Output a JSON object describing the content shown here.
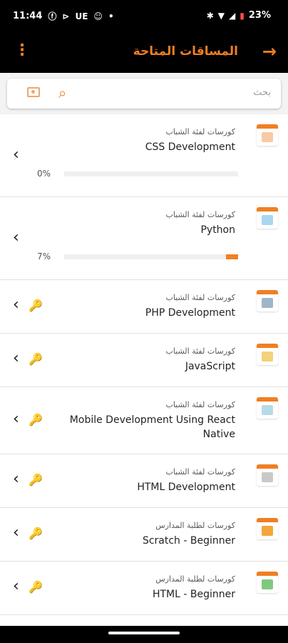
{
  "status": {
    "time": "11:44",
    "carrier_label": "UE",
    "dot": "•",
    "battery": "23%",
    "left_icons": [
      "facebook-icon",
      "playstation-icon",
      "snapchat-icon"
    ],
    "right_icons": [
      "bluetooth-icon",
      "wifi-icon",
      "signal-icon",
      "battery-icon"
    ]
  },
  "app_bar": {
    "title": "المساقات المتاحة",
    "back_glyph": "→",
    "menu_glyph": "⋮"
  },
  "search": {
    "placeholder": "بحث"
  },
  "courses": [
    {
      "category": "كورسات لفئة الشباب",
      "title": "CSS Development",
      "progress_text": "0%",
      "progress": 0,
      "locked": false
    },
    {
      "category": "كورسات لفئة الشباب",
      "title": "Python",
      "progress_text": "7%",
      "progress": 0.07,
      "locked": false
    },
    {
      "category": "كورسات لفئة الشباب",
      "title": "PHP Development",
      "locked": true
    },
    {
      "category": "كورسات لفئة الشباب",
      "title": "JavaScript",
      "locked": true
    },
    {
      "category": "كورسات لفئة الشباب",
      "title_line1": "Mobile Development Using React",
      "title_line2": "Native",
      "locked": true
    },
    {
      "category": "كورسات لفئة الشباب",
      "title": "HTML Development",
      "locked": true
    },
    {
      "category": "كورسات لطلبة المدارس",
      "title": "Scratch - Beginner",
      "locked": true
    },
    {
      "category": "كورسات لطلبة المدارس",
      "title": "HTML - Beginner",
      "locked": true
    }
  ],
  "colors": {
    "accent": "#f07f23",
    "status_bg": "#000000"
  }
}
